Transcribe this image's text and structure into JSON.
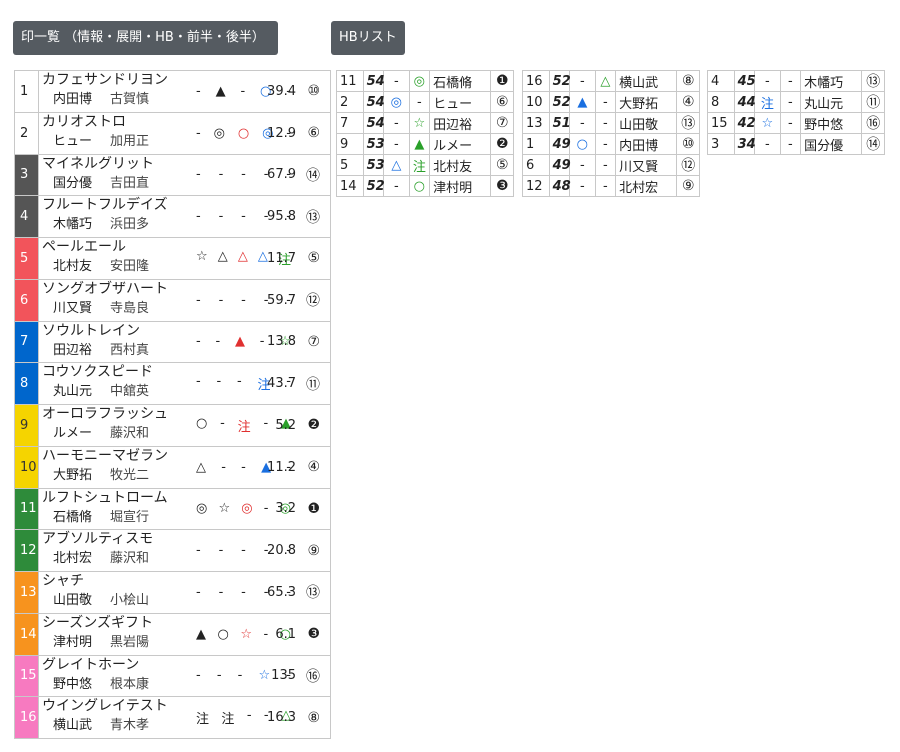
{
  "buttons": {
    "marks": "印一覧 （情報・展開・HB・前半・後半）",
    "hb": "HBリスト"
  },
  "colors": {
    "frame": [
      "#ffffff",
      "#ffffff",
      "#555555",
      "#555555",
      "#f2545b",
      "#f2545b",
      "#0066cc",
      "#0066cc",
      "#f5d400",
      "#f5d400",
      "#2e8b3a",
      "#2e8b3a",
      "#f7931e",
      "#f7931e",
      "#f77ac0",
      "#f77ac0"
    ]
  },
  "horses": [
    {
      "no": "1",
      "name": "カフェサンドリヨン",
      "jockey": "内田博",
      "trainer": "古賀慎",
      "marks": [
        [
          "-",
          ""
        ],
        [
          "▲",
          "c-blk"
        ],
        [
          "-",
          ""
        ],
        [
          "○",
          "c-blue"
        ],
        [
          "-",
          ""
        ]
      ],
      "odds": "39.4",
      "rank": "⑩"
    },
    {
      "no": "2",
      "name": "カリオストロ",
      "jockey": "ヒュー",
      "trainer": "加用正",
      "marks": [
        [
          "-",
          ""
        ],
        [
          "◎",
          "c-blk"
        ],
        [
          "○",
          "c-red"
        ],
        [
          "◎",
          "c-blue"
        ],
        [
          "-",
          ""
        ]
      ],
      "odds": "12.9",
      "rank": "⑥"
    },
    {
      "no": "3",
      "name": "マイネルグリット",
      "jockey": "国分優",
      "trainer": "吉田直",
      "marks": [
        [
          "-",
          ""
        ],
        [
          "-",
          ""
        ],
        [
          "-",
          ""
        ],
        [
          "-",
          ""
        ],
        [
          "-",
          ""
        ]
      ],
      "odds": "67.9",
      "rank": "⑭"
    },
    {
      "no": "4",
      "name": "フルートフルデイズ",
      "jockey": "木幡巧",
      "trainer": "浜田多",
      "marks": [
        [
          "-",
          ""
        ],
        [
          "-",
          ""
        ],
        [
          "-",
          ""
        ],
        [
          "-",
          ""
        ],
        [
          "-",
          ""
        ]
      ],
      "odds": "95.8",
      "rank": "⑬"
    },
    {
      "no": "5",
      "name": "ペールエール",
      "jockey": "北村友",
      "trainer": "安田隆",
      "marks": [
        [
          "☆",
          "c-blk"
        ],
        [
          "△",
          "c-blk"
        ],
        [
          "△",
          "c-red"
        ],
        [
          "△",
          "c-blue"
        ],
        [
          "注",
          "c-green"
        ]
      ],
      "odds": "11.7",
      "rank": "⑤"
    },
    {
      "no": "6",
      "name": "ソングオブザハート",
      "jockey": "川又賢",
      "trainer": "寺島良",
      "marks": [
        [
          "-",
          ""
        ],
        [
          "-",
          ""
        ],
        [
          "-",
          ""
        ],
        [
          "-",
          ""
        ],
        [
          "-",
          ""
        ]
      ],
      "odds": "59.7",
      "rank": "⑫"
    },
    {
      "no": "7",
      "name": "ソウルトレイン",
      "jockey": "田辺裕",
      "trainer": "西村真",
      "marks": [
        [
          "-",
          ""
        ],
        [
          "-",
          ""
        ],
        [
          "▲",
          "c-red"
        ],
        [
          "-",
          ""
        ],
        [
          "☆",
          "c-green"
        ]
      ],
      "odds": "13.8",
      "rank": "⑦"
    },
    {
      "no": "8",
      "name": "コウソクスピード",
      "jockey": "丸山元",
      "trainer": "中舘英",
      "marks": [
        [
          "-",
          ""
        ],
        [
          "-",
          ""
        ],
        [
          "-",
          ""
        ],
        [
          "注",
          "c-blue"
        ],
        [
          "-",
          ""
        ]
      ],
      "odds": "43.7",
      "rank": "⑪"
    },
    {
      "no": "9",
      "name": "オーロラフラッシュ",
      "jockey": "ルメー",
      "trainer": "藤沢和",
      "marks": [
        [
          "○",
          "c-blk"
        ],
        [
          "-",
          ""
        ],
        [
          "注",
          "c-red"
        ],
        [
          "-",
          ""
        ],
        [
          "▲",
          "c-green"
        ]
      ],
      "odds": "5.2",
      "rank": "❷"
    },
    {
      "no": "10",
      "name": "ハーモニーマゼラン",
      "jockey": "大野拓",
      "trainer": "牧光二",
      "marks": [
        [
          "△",
          "c-blk"
        ],
        [
          "-",
          ""
        ],
        [
          "-",
          ""
        ],
        [
          "▲",
          "c-blue"
        ],
        [
          "-",
          ""
        ]
      ],
      "odds": "11.2",
      "rank": "④"
    },
    {
      "no": "11",
      "name": "ルフトシュトローム",
      "jockey": "石橋脩",
      "trainer": "堀宣行",
      "marks": [
        [
          "◎",
          "c-blk"
        ],
        [
          "☆",
          "c-blk"
        ],
        [
          "◎",
          "c-red"
        ],
        [
          "-",
          ""
        ],
        [
          "◎",
          "c-green"
        ]
      ],
      "odds": "3.2",
      "rank": "❶"
    },
    {
      "no": "12",
      "name": "アブソルティスモ",
      "jockey": "北村宏",
      "trainer": "藤沢和",
      "marks": [
        [
          "-",
          ""
        ],
        [
          "-",
          ""
        ],
        [
          "-",
          ""
        ],
        [
          "-",
          ""
        ],
        [
          "-",
          ""
        ]
      ],
      "odds": "20.8",
      "rank": "⑨"
    },
    {
      "no": "13",
      "name": "シャチ",
      "jockey": "山田敬",
      "trainer": "小桧山",
      "marks": [
        [
          "-",
          ""
        ],
        [
          "-",
          ""
        ],
        [
          "-",
          ""
        ],
        [
          "-",
          ""
        ],
        [
          "-",
          ""
        ]
      ],
      "odds": "65.3",
      "rank": "⑬"
    },
    {
      "no": "14",
      "name": "シーズンズギフト",
      "jockey": "津村明",
      "trainer": "黒岩陽",
      "marks": [
        [
          "▲",
          "c-blk"
        ],
        [
          "○",
          "c-blk"
        ],
        [
          "☆",
          "c-red"
        ],
        [
          "-",
          ""
        ],
        [
          "○",
          "c-green"
        ]
      ],
      "odds": "6.1",
      "rank": "❸"
    },
    {
      "no": "15",
      "name": "グレイトホーン",
      "jockey": "野中悠",
      "trainer": "根本康",
      "marks": [
        [
          "-",
          ""
        ],
        [
          "-",
          ""
        ],
        [
          "-",
          ""
        ],
        [
          "☆",
          "c-blue"
        ],
        [
          "-",
          ""
        ]
      ],
      "odds": "135",
      "rank": "⑯"
    },
    {
      "no": "16",
      "name": "ウイングレイテスト",
      "jockey": "横山武",
      "trainer": "青木孝",
      "marks": [
        [
          "注",
          "c-blk"
        ],
        [
          "注",
          "c-blk"
        ],
        [
          "-",
          ""
        ],
        [
          "-",
          ""
        ],
        [
          "△",
          "c-green"
        ]
      ],
      "odds": "16.3",
      "rank": "⑧"
    }
  ],
  "hb_lists": [
    [
      {
        "no": "11",
        "score": "54",
        "m1": [
          "-",
          ""
        ],
        "m2": [
          "◎",
          "c-green"
        ],
        "jockey": "石橋脩",
        "rank": "❶"
      },
      {
        "no": "2",
        "score": "54",
        "m1": [
          "◎",
          "c-blue"
        ],
        "m2": [
          "-",
          ""
        ],
        "jockey": "ヒュー",
        "rank": "⑥"
      },
      {
        "no": "7",
        "score": "54",
        "m1": [
          "-",
          ""
        ],
        "m2": [
          "☆",
          "c-green"
        ],
        "jockey": "田辺裕",
        "rank": "⑦"
      },
      {
        "no": "9",
        "score": "53",
        "m1": [
          "-",
          ""
        ],
        "m2": [
          "▲",
          "c-green"
        ],
        "jockey": "ルメー",
        "rank": "❷"
      },
      {
        "no": "5",
        "score": "53",
        "m1": [
          "△",
          "c-blue"
        ],
        "m2": [
          "注",
          "c-green"
        ],
        "jockey": "北村友",
        "rank": "⑤"
      },
      {
        "no": "14",
        "score": "52",
        "m1": [
          "-",
          ""
        ],
        "m2": [
          "○",
          "c-green"
        ],
        "jockey": "津村明",
        "rank": "❸"
      }
    ],
    [
      {
        "no": "16",
        "score": "52",
        "m1": [
          "-",
          ""
        ],
        "m2": [
          "△",
          "c-green"
        ],
        "jockey": "横山武",
        "rank": "⑧"
      },
      {
        "no": "10",
        "score": "52",
        "m1": [
          "▲",
          "c-blue"
        ],
        "m2": [
          "-",
          ""
        ],
        "jockey": "大野拓",
        "rank": "④"
      },
      {
        "no": "13",
        "score": "51",
        "m1": [
          "-",
          ""
        ],
        "m2": [
          "-",
          ""
        ],
        "jockey": "山田敬",
        "rank": "⑬"
      },
      {
        "no": "1",
        "score": "49",
        "m1": [
          "○",
          "c-blue"
        ],
        "m2": [
          "-",
          ""
        ],
        "jockey": "内田博",
        "rank": "⑩"
      },
      {
        "no": "6",
        "score": "49",
        "m1": [
          "-",
          ""
        ],
        "m2": [
          "-",
          ""
        ],
        "jockey": "川又賢",
        "rank": "⑫"
      },
      {
        "no": "12",
        "score": "48",
        "m1": [
          "-",
          ""
        ],
        "m2": [
          "-",
          ""
        ],
        "jockey": "北村宏",
        "rank": "⑨"
      }
    ],
    [
      {
        "no": "4",
        "score": "45",
        "m1": [
          "-",
          ""
        ],
        "m2": [
          "-",
          ""
        ],
        "jockey": "木幡巧",
        "rank": "⑬"
      },
      {
        "no": "8",
        "score": "44",
        "m1": [
          "注",
          "c-blue"
        ],
        "m2": [
          "-",
          ""
        ],
        "jockey": "丸山元",
        "rank": "⑪"
      },
      {
        "no": "15",
        "score": "42",
        "m1": [
          "☆",
          "c-blue"
        ],
        "m2": [
          "-",
          ""
        ],
        "jockey": "野中悠",
        "rank": "⑯"
      },
      {
        "no": "3",
        "score": "34",
        "m1": [
          "-",
          ""
        ],
        "m2": [
          "-",
          ""
        ],
        "jockey": "国分優",
        "rank": "⑭"
      }
    ]
  ]
}
